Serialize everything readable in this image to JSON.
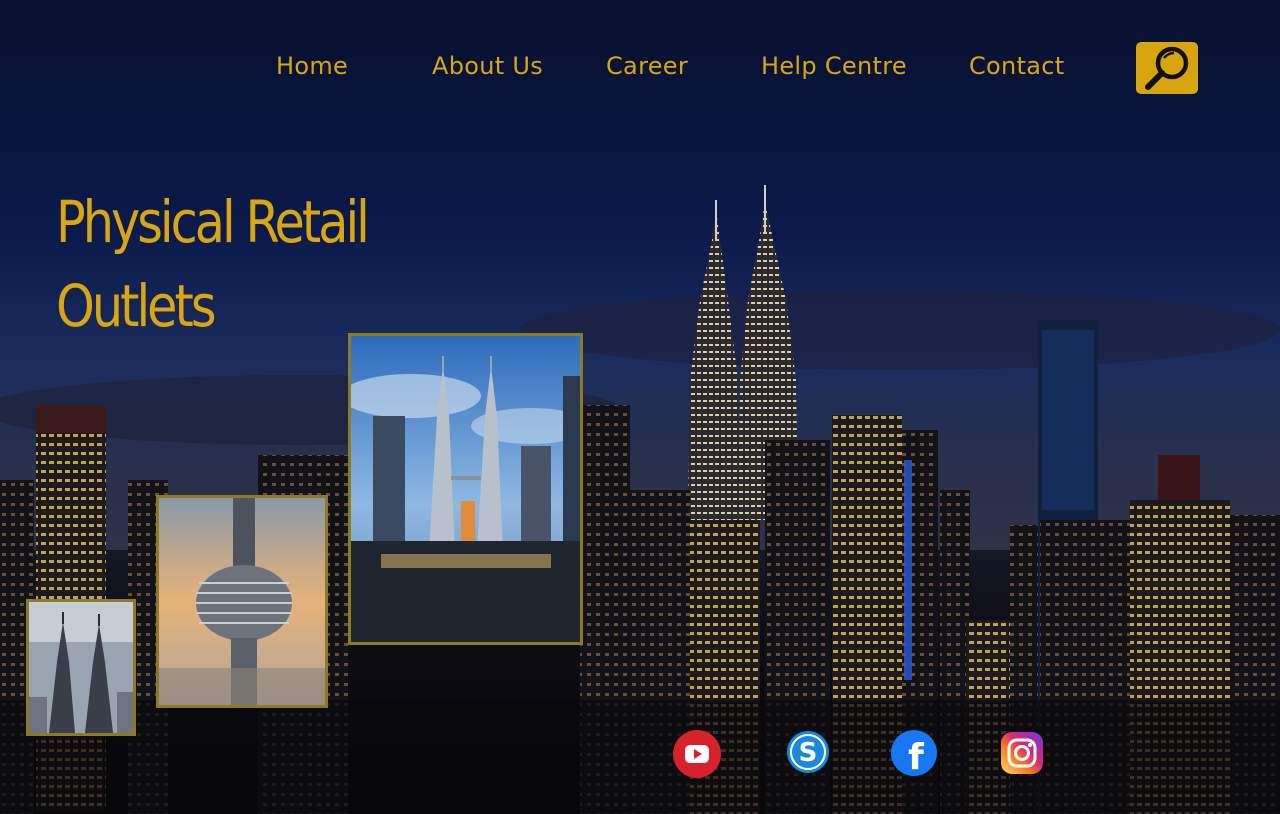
{
  "nav": {
    "items": [
      {
        "label": "Home"
      },
      {
        "label": "About Us"
      },
      {
        "label": "Career"
      },
      {
        "label": "Help Centre"
      },
      {
        "label": "Contact"
      }
    ],
    "search_icon": "search-icon"
  },
  "hero": {
    "title_line1": "Physical Retail",
    "title_line2": "Outlets"
  },
  "gallery": [
    {
      "icon": "petronas-aerial-photo"
    },
    {
      "icon": "kl-tower-photo"
    },
    {
      "icon": "petronas-towers-photo"
    }
  ],
  "social": [
    {
      "icon": "youtube-icon",
      "color": "#d7212b"
    },
    {
      "icon": "skype-icon",
      "color": "#1a8ad8"
    },
    {
      "icon": "facebook-icon",
      "color": "#1877f2"
    },
    {
      "icon": "instagram-icon",
      "color": "#d62976"
    }
  ],
  "colors": {
    "accent": "#d8a613",
    "frame": "#8c7a26",
    "sky": "#0b1a4a"
  }
}
